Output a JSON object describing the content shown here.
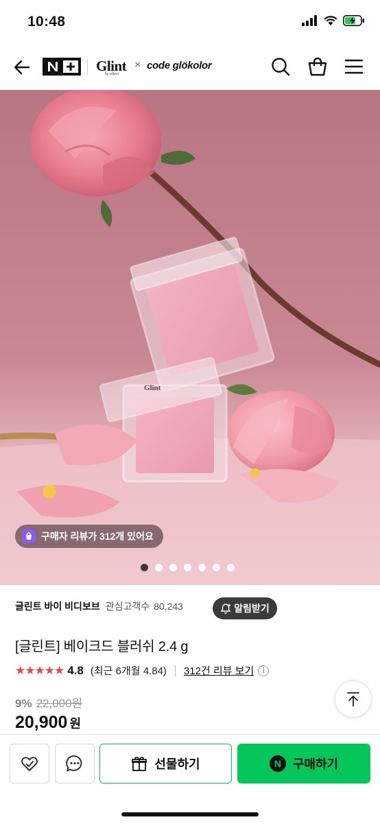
{
  "status_bar": {
    "time": "10:48"
  },
  "header": {
    "logo": "N+",
    "brand": "Glint",
    "brand_by": "by vdivov",
    "collab_x": "×",
    "collab": "code glökolor"
  },
  "hero": {
    "lid_brand": "Glint",
    "review_pill": "구매자 리뷰가 312개 있어요",
    "slides_total": 7,
    "active_slide": 1
  },
  "product": {
    "store_name": "글린트 바이 비디보브",
    "followers_label": "관심고객수",
    "followers_count": "80,243",
    "notify_label": "알림받기",
    "title": "[글린트] 베이크드 블러쉬 2.4 g",
    "stars": "★★★★★",
    "rating": "4.8",
    "recent_rating": "(최근 6개월 4.84)",
    "reviews_link": "312건 리뷰 보기",
    "info": "i",
    "discount": "9%",
    "original_price": "22,000원",
    "price": "20,900",
    "currency": "원"
  },
  "bottom_bar": {
    "gift_label": "선물하기",
    "buy_label": "구매하기",
    "pay_mark": "N"
  },
  "colors": {
    "accent_green": "#03c75a",
    "star_red": "#e04848",
    "hero_bg": "#c98a96"
  }
}
